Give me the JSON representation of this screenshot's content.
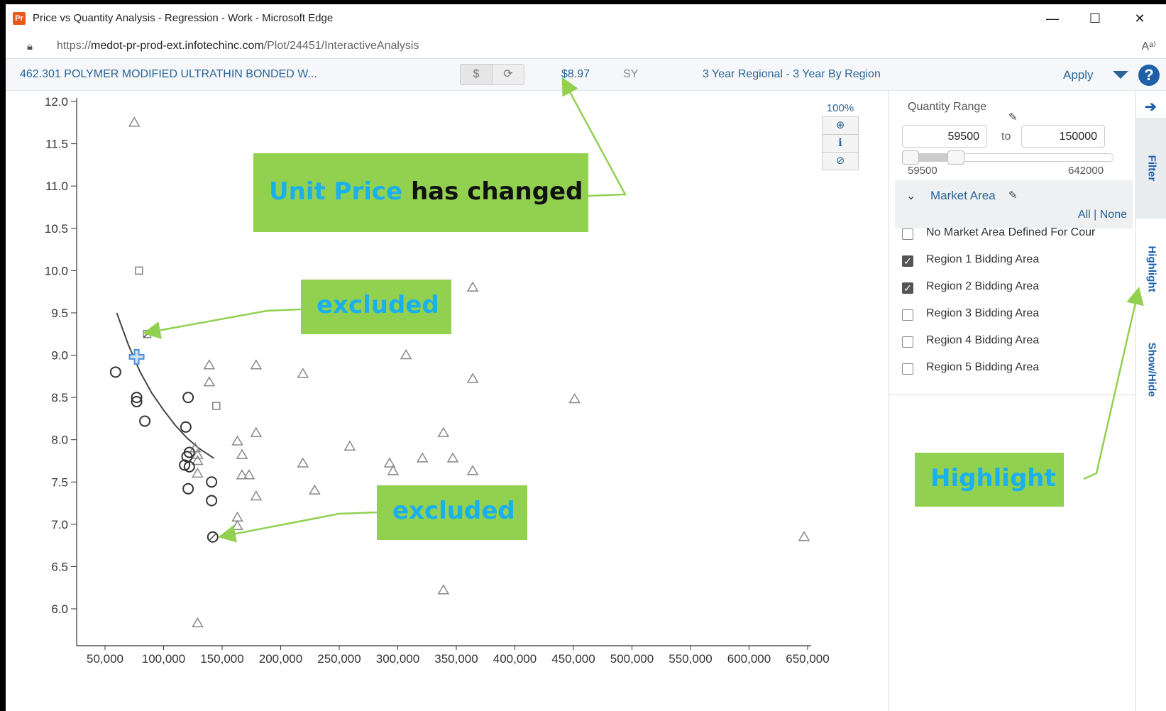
{
  "window": {
    "app_icon": "Pr",
    "title": "Price vs Quantity Analysis - Regression - Work - Microsoft Edge",
    "minimize": "—",
    "maximize": "☐",
    "close": "✕"
  },
  "address_bar": {
    "url_prefix": "https://",
    "url_host": "medot-pr-prod-ext.infotechinc.com",
    "url_path": "/Plot/24451/InteractiveAnalysis",
    "read_aloud": "Aᵃ⁾"
  },
  "toolbar": {
    "item_title": "462.301 POLYMER MODIFIED ULTRATHIN BONDED W...",
    "dollar_button": "$",
    "refresh_button": "⟳",
    "unit_price": "$8.97",
    "unit": "SY",
    "regional_selection": "3 Year Regional - 3 Year By Region",
    "apply_label": "Apply",
    "help": "?"
  },
  "zoom": {
    "level": "100%",
    "zoom_in": "⊕",
    "info": "ℹ",
    "reset": "⊘"
  },
  "filter_panel": {
    "quantity_range_label": "Quantity Range",
    "min_value": "59500",
    "to_label": "to",
    "max_value": "150000",
    "slider_min_label": "59500",
    "slider_max_label": "642000",
    "slider_low_fraction": 0.0,
    "slider_high_fraction": 0.155,
    "market_area_label": "Market Area",
    "all_none": "All | None",
    "market_areas": [
      {
        "label": "No Market Area Defined For Cour",
        "checked": false
      },
      {
        "label": "Region 1 Bidding Area",
        "checked": true
      },
      {
        "label": "Region 2 Bidding Area",
        "checked": true
      },
      {
        "label": "Region 3 Bidding Area",
        "checked": false
      },
      {
        "label": "Region 4 Bidding Area",
        "checked": false
      },
      {
        "label": "Region 5 Bidding Area",
        "checked": false
      }
    ]
  },
  "side_tabs": {
    "arrow": "➔",
    "filter": "Filter",
    "highlight": "Highlight",
    "show_hide": "Show/Hide"
  },
  "annotations": {
    "unit_price_part1": "Unit Price",
    "unit_price_part2": "has changed",
    "excluded_1": "excluded",
    "excluded_2": "excluded",
    "highlight": "Highlight",
    "color_callout": "#92d050",
    "color_callout_text": "#1ab0ee"
  },
  "chart_data": {
    "type": "scatter",
    "xlim": [
      50000,
      650000
    ],
    "ylim": [
      5.5,
      12.0
    ],
    "x_ticks": [
      "50,000",
      "100,000",
      "150,000",
      "200,000",
      "250,000",
      "300,000",
      "350,000",
      "400,000",
      "450,000",
      "500,000",
      "550,000",
      "600,000",
      "650,000"
    ],
    "y_ticks": [
      "12.0",
      "11.5",
      "11.0",
      "10.5",
      "10.0",
      "9.5",
      "9.0",
      "8.5",
      "8.0",
      "7.5",
      "7.0",
      "6.5",
      "6.0"
    ],
    "colors": {
      "circle": "#333333",
      "triangle": "#888888",
      "square": "#888888",
      "highlight": "#4a90d9"
    },
    "circles": [
      [
        59000,
        8.8
      ],
      [
        77000,
        8.5
      ],
      [
        77000,
        8.45
      ],
      [
        84000,
        8.22
      ],
      [
        121000,
        8.5
      ],
      [
        119000,
        8.15
      ],
      [
        122000,
        7.85
      ],
      [
        120000,
        7.8
      ],
      [
        118000,
        7.7
      ],
      [
        122000,
        7.68
      ],
      [
        121000,
        7.42
      ],
      [
        141000,
        7.5
      ],
      [
        141000,
        7.28
      ],
      [
        142000,
        6.85
      ]
    ],
    "triangles": [
      [
        75000,
        11.75
      ],
      [
        364000,
        9.8
      ],
      [
        307000,
        9.0
      ],
      [
        139000,
        8.88
      ],
      [
        179000,
        8.88
      ],
      [
        219000,
        8.78
      ],
      [
        139000,
        8.68
      ],
      [
        364000,
        8.72
      ],
      [
        451000,
        8.48
      ],
      [
        179000,
        8.08
      ],
      [
        339000,
        8.08
      ],
      [
        163000,
        7.98
      ],
      [
        259000,
        7.92
      ],
      [
        127000,
        7.9
      ],
      [
        129000,
        7.82
      ],
      [
        167000,
        7.82
      ],
      [
        129000,
        7.75
      ],
      [
        321000,
        7.78
      ],
      [
        347000,
        7.78
      ],
      [
        219000,
        7.72
      ],
      [
        293000,
        7.72
      ],
      [
        296000,
        7.63
      ],
      [
        364000,
        7.63
      ],
      [
        129000,
        7.6
      ],
      [
        167000,
        7.58
      ],
      [
        173000,
        7.58
      ],
      [
        229000,
        7.4
      ],
      [
        179000,
        7.33
      ],
      [
        163000,
        7.08
      ],
      [
        163000,
        6.98
      ],
      [
        339000,
        6.22
      ],
      [
        129000,
        5.83
      ],
      [
        647000,
        6.85
      ]
    ],
    "squares": [
      [
        79000,
        10.0
      ],
      [
        86000,
        9.25
      ],
      [
        145000,
        8.4
      ]
    ],
    "excluded": [
      [
        86000,
        9.25
      ],
      [
        142000,
        6.85
      ]
    ],
    "highlighted": [
      [
        77000,
        8.98
      ]
    ],
    "regression_curve": [
      [
        60000,
        9.5
      ],
      [
        70000,
        9.12
      ],
      [
        80000,
        8.8
      ],
      [
        90000,
        8.55
      ],
      [
        100000,
        8.35
      ],
      [
        110000,
        8.17
      ],
      [
        120000,
        8.02
      ],
      [
        130000,
        7.9
      ],
      [
        143000,
        7.78
      ]
    ]
  }
}
